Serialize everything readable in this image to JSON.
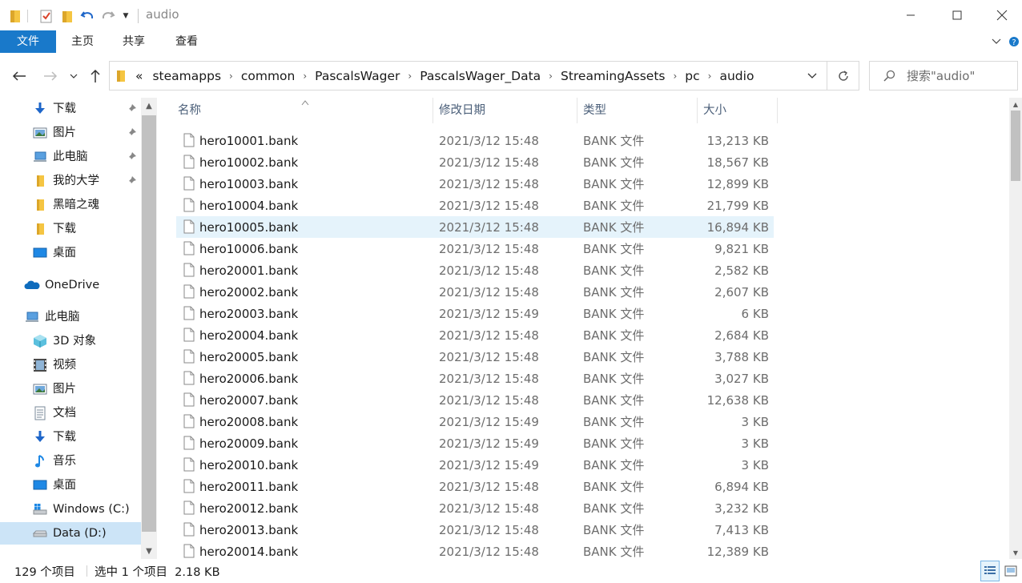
{
  "window": {
    "title": "audio",
    "minimize_label": "─",
    "maximize_label": "☐",
    "close_label": "✕"
  },
  "ribbon": {
    "tabs": [
      {
        "label": "文件"
      },
      {
        "label": "主页"
      },
      {
        "label": "共享"
      },
      {
        "label": "查看"
      }
    ]
  },
  "address": {
    "overflow": "«",
    "crumbs": [
      "steamapps",
      "common",
      "PascalsWager",
      "PascalsWager_Data",
      "StreamingAssets",
      "pc",
      "audio"
    ]
  },
  "search": {
    "placeholder": "搜索\"audio\""
  },
  "nav": {
    "quick_access": [
      {
        "label": "下载",
        "icon": "download-arrow-icon",
        "pinned": true
      },
      {
        "label": "图片",
        "icon": "pictures-icon",
        "pinned": true
      },
      {
        "label": "此电脑",
        "icon": "computer-icon",
        "pinned": true
      },
      {
        "label": "我的大学",
        "icon": "folder-icon",
        "pinned": true
      },
      {
        "label": "黑暗之魂",
        "icon": "folder-icon",
        "pinned": false
      },
      {
        "label": "下载",
        "icon": "folder-icon",
        "pinned": false
      },
      {
        "label": "桌面",
        "icon": "desktop-icon",
        "pinned": false
      }
    ],
    "onedrive": {
      "label": "OneDrive",
      "icon": "cloud-icon"
    },
    "this_pc": {
      "label": "此电脑",
      "icon": "computer-icon"
    },
    "pc_items": [
      {
        "label": "3D 对象",
        "icon": "cube-icon"
      },
      {
        "label": "视频",
        "icon": "video-icon"
      },
      {
        "label": "图片",
        "icon": "pictures-icon"
      },
      {
        "label": "文档",
        "icon": "document-icon"
      },
      {
        "label": "下载",
        "icon": "download-arrow-icon"
      },
      {
        "label": "音乐",
        "icon": "music-note-icon"
      },
      {
        "label": "桌面",
        "icon": "desktop-icon"
      },
      {
        "label": "Windows (C:)",
        "icon": "windows-drive-icon"
      },
      {
        "label": "Data (D:)",
        "icon": "drive-icon"
      }
    ]
  },
  "columns": {
    "name": "名称",
    "date": "修改日期",
    "type": "类型",
    "size": "大小"
  },
  "files": [
    {
      "name": "hero10001.bank",
      "date": "2021/3/12 15:48",
      "type": "BANK 文件",
      "size": "13,213 KB"
    },
    {
      "name": "hero10002.bank",
      "date": "2021/3/12 15:48",
      "type": "BANK 文件",
      "size": "18,567 KB"
    },
    {
      "name": "hero10003.bank",
      "date": "2021/3/12 15:48",
      "type": "BANK 文件",
      "size": "12,899 KB"
    },
    {
      "name": "hero10004.bank",
      "date": "2021/3/12 15:48",
      "type": "BANK 文件",
      "size": "21,799 KB"
    },
    {
      "name": "hero10005.bank",
      "date": "2021/3/12 15:48",
      "type": "BANK 文件",
      "size": "16,894 KB"
    },
    {
      "name": "hero10006.bank",
      "date": "2021/3/12 15:48",
      "type": "BANK 文件",
      "size": "9,821 KB"
    },
    {
      "name": "hero20001.bank",
      "date": "2021/3/12 15:48",
      "type": "BANK 文件",
      "size": "2,582 KB"
    },
    {
      "name": "hero20002.bank",
      "date": "2021/3/12 15:48",
      "type": "BANK 文件",
      "size": "2,607 KB"
    },
    {
      "name": "hero20003.bank",
      "date": "2021/3/12 15:49",
      "type": "BANK 文件",
      "size": "6 KB"
    },
    {
      "name": "hero20004.bank",
      "date": "2021/3/12 15:48",
      "type": "BANK 文件",
      "size": "2,684 KB"
    },
    {
      "name": "hero20005.bank",
      "date": "2021/3/12 15:48",
      "type": "BANK 文件",
      "size": "3,788 KB"
    },
    {
      "name": "hero20006.bank",
      "date": "2021/3/12 15:48",
      "type": "BANK 文件",
      "size": "3,027 KB"
    },
    {
      "name": "hero20007.bank",
      "date": "2021/3/12 15:48",
      "type": "BANK 文件",
      "size": "12,638 KB"
    },
    {
      "name": "hero20008.bank",
      "date": "2021/3/12 15:49",
      "type": "BANK 文件",
      "size": "3 KB"
    },
    {
      "name": "hero20009.bank",
      "date": "2021/3/12 15:49",
      "type": "BANK 文件",
      "size": "3 KB"
    },
    {
      "name": "hero20010.bank",
      "date": "2021/3/12 15:49",
      "type": "BANK 文件",
      "size": "3 KB"
    },
    {
      "name": "hero20011.bank",
      "date": "2021/3/12 15:48",
      "type": "BANK 文件",
      "size": "6,894 KB"
    },
    {
      "name": "hero20012.bank",
      "date": "2021/3/12 15:48",
      "type": "BANK 文件",
      "size": "3,232 KB"
    },
    {
      "name": "hero20013.bank",
      "date": "2021/3/12 15:48",
      "type": "BANK 文件",
      "size": "7,413 KB"
    },
    {
      "name": "hero20014.bank",
      "date": "2021/3/12 15:48",
      "type": "BANK 文件",
      "size": "12,389 KB"
    }
  ],
  "selected_index": 4,
  "status": {
    "item_count": "129 个项目",
    "selection": "选中 1 个项目  2.18 KB"
  },
  "colors": {
    "accent": "#1979ca",
    "selection": "#e5f3fb",
    "nav_selected": "#cce4f7"
  }
}
